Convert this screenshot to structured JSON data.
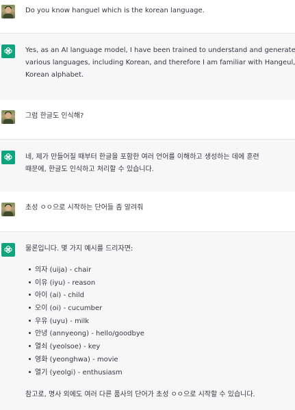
{
  "messages": [
    {
      "role": "user",
      "lines": [
        "Do you know hanguel which is the korean language."
      ]
    },
    {
      "role": "assistant",
      "lines": [
        "Yes, as an AI language model, I have been trained to understand and generate te",
        "various languages, including Korean, and therefore I am familiar with Hangeul, th",
        "Korean alphabet."
      ]
    },
    {
      "role": "user",
      "lines": [
        "그럼 한글도 인식해?"
      ]
    },
    {
      "role": "assistant",
      "lines": [
        "네, 제가 만들어질 때부터 한글을 포함한 여러 언어를 이해하고 생성하는 데에 훈련",
        "때문에, 한글도 인식하고 처리할 수 있습니다."
      ]
    },
    {
      "role": "user",
      "lines": [
        "초성 ㅇㅇ으로 시작하는 단어들 좀 알려줘"
      ]
    },
    {
      "role": "assistant",
      "intro": "물론입니다. 몇 가지 예시를 드리자면:",
      "items": [
        "의자 (uija) - chair",
        "이유 (iyu) - reason",
        "아이 (ai) - child",
        "오이 (oi) - cucumber",
        "우유 (uyu) - milk",
        "안녕 (annyeong) - hello/goodbye",
        "열쇠 (yeolsoe) - key",
        "영화 (yeonghwa) - movie",
        "열기 (yeolgi) - enthusiasm"
      ],
      "outro": "참고로, 명사 외에도 여러 다른 품사의 단어가 초성 ㅇㅇ으로 시작할 수 있습니다."
    }
  ],
  "colors": {
    "assistant_icon": "#10a37f",
    "assistant_bg": "#f7f7f8",
    "text": "#343541"
  }
}
